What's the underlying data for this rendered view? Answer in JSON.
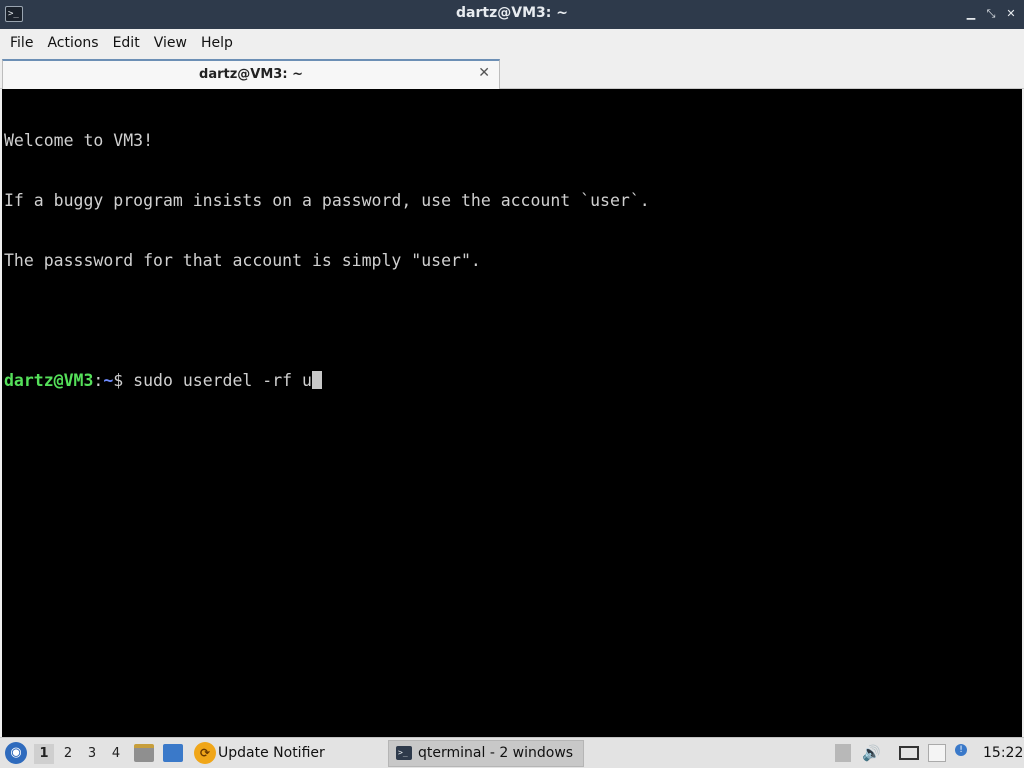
{
  "window": {
    "title": "dartz@VM3: ~",
    "app_icon": "terminal-icon",
    "controls": [
      "minimize-icon",
      "restore-icon",
      "close-icon"
    ]
  },
  "menubar": {
    "items": [
      "File",
      "Actions",
      "Edit",
      "View",
      "Help"
    ]
  },
  "tabs": [
    {
      "label": "dartz@VM3: ~",
      "close_icon": "close-icon"
    }
  ],
  "terminal": {
    "lines": [
      "Welcome to VM3!",
      "If a buggy program insists on a password, use the account `user`.",
      "The passsword for that account is simply \"user\".",
      ""
    ],
    "prompt": {
      "user_host": "dartz@VM3",
      "separator": ":",
      "path": "~",
      "symbol": "$ ",
      "command": "sudo userdel -rf u"
    },
    "colors": {
      "background": "#000000",
      "text": "#d0d0d0",
      "user_host": "#55e05a",
      "path": "#6f8cff"
    }
  },
  "taskbar": {
    "desktops": [
      "1",
      "2",
      "3",
      "4"
    ],
    "active_desktop": "1",
    "update_notifier_label": "Update Notifier",
    "task_label": "qterminal - 2 windows",
    "clock": "15:22"
  }
}
